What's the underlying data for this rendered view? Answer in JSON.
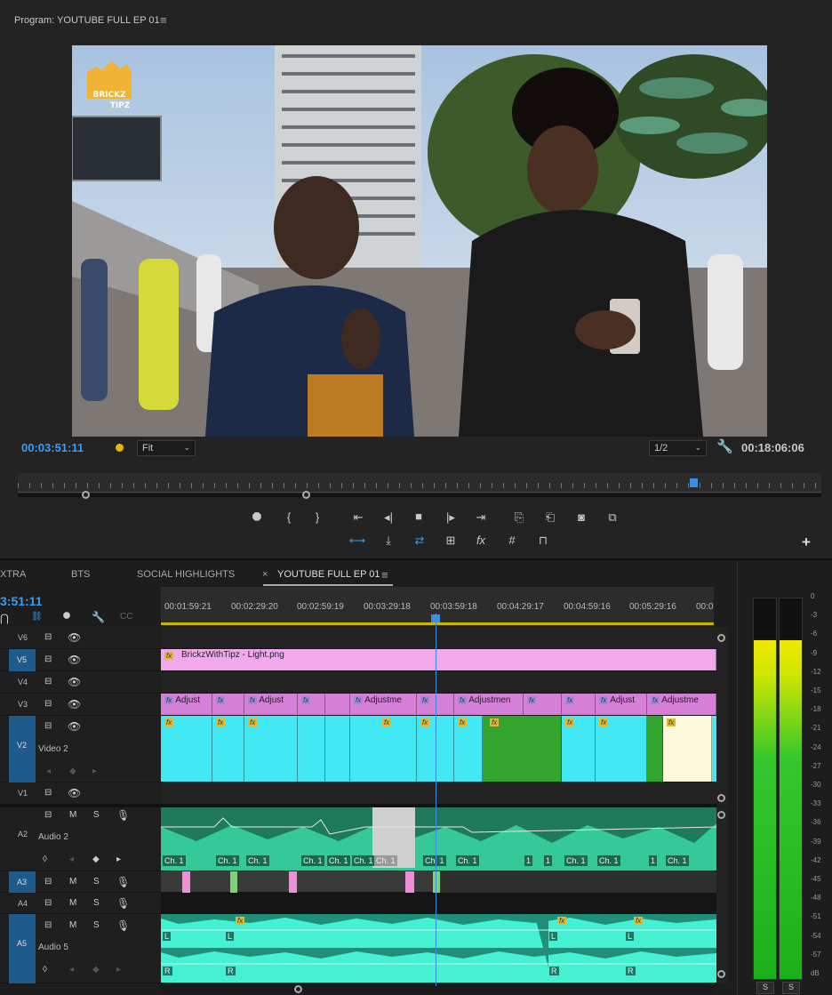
{
  "program": {
    "title": "Program: YOUTUBE FULL EP 01",
    "menu_icon": "≡",
    "logo_text": "BRICKZ WITH TIPZ",
    "timecode_current": "00:03:51:11",
    "timecode_duration": "00:18:06:06",
    "fit_select": "Fit",
    "resolution_select": "1/2",
    "transport": [
      "marker",
      "in",
      "out",
      "go-to-in",
      "step-back",
      "stop",
      "step-forward",
      "go-to-out",
      "lift",
      "extract",
      "export-frame",
      "compare"
    ],
    "transport2": [
      "loop",
      "insert",
      "overwrite",
      "safe-margins",
      "fx",
      "grid",
      "ruler"
    ],
    "add_button": "+"
  },
  "timeline": {
    "tabs": [
      "XTRA",
      "BTS",
      "SOCIAL HIGHLIGHTS",
      "YOUTUBE FULL EP 01"
    ],
    "close_icon": "×",
    "menu_icon": "≡",
    "timecode": "3:51:11",
    "ruler_labels": [
      "00:01:59:21",
      "00:02:29:20",
      "00:02:59:19",
      "00:03:29:18",
      "00:03:59:18",
      "00:04:29:17",
      "00:04:59:16",
      "00:05:29:16",
      "00:0"
    ],
    "tracks": {
      "V6": {
        "label": "V6"
      },
      "V5": {
        "label": "V5"
      },
      "V4": {
        "label": "V4"
      },
      "V3": {
        "label": "V3"
      },
      "V2": {
        "label": "V2",
        "name": "Video 2"
      },
      "V1": {
        "label": "V1"
      },
      "A2": {
        "label": "A2",
        "name": "Audio 2"
      },
      "A3": {
        "label": "A3"
      },
      "A4": {
        "label": "A4"
      },
      "A5": {
        "label": "A5",
        "name": "Audio 5"
      }
    },
    "mute": "M",
    "solo": "S",
    "v5_clip": "BrickzWithTipz - Light.png",
    "fx": "fx",
    "adj_labels": [
      "Adjust",
      "Adjust",
      "Adjustme",
      "Adjustmen",
      "Adjust",
      "Adjustme"
    ],
    "channel_label": "Ch. 1",
    "channel_short": "1",
    "channel_L": "L",
    "channel_R": "R"
  },
  "meter": {
    "scale": [
      "0",
      "-3",
      "-6",
      "-9",
      "-12",
      "-15",
      "-18",
      "-21",
      "-24",
      "-27",
      "-30",
      "-33",
      "-36",
      "-39",
      "-42",
      "-45",
      "-48",
      "-51",
      "-54",
      "-57",
      "dB"
    ],
    "solo_left": "S",
    "solo_right": "S",
    "level_fraction": 0.89
  }
}
